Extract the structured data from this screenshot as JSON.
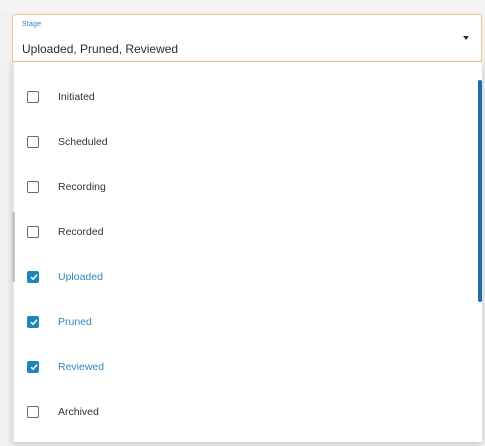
{
  "select": {
    "label": "Stage",
    "value": "Uploaded, Pruned, Reviewed",
    "caret_icon": "caret-down-icon"
  },
  "options": [
    {
      "label": "Initiated",
      "checked": false
    },
    {
      "label": "Scheduled",
      "checked": false
    },
    {
      "label": "Recording",
      "checked": false
    },
    {
      "label": "Recorded",
      "checked": false
    },
    {
      "label": "Uploaded",
      "checked": true
    },
    {
      "label": "Pruned",
      "checked": true
    },
    {
      "label": "Reviewed",
      "checked": true
    },
    {
      "label": "Archived",
      "checked": false
    }
  ],
  "colors": {
    "accent": "#1f87b7",
    "selected_text": "#2d89b9",
    "select_border": "#e8c98a",
    "scrollbar": "#1f6ea8"
  }
}
